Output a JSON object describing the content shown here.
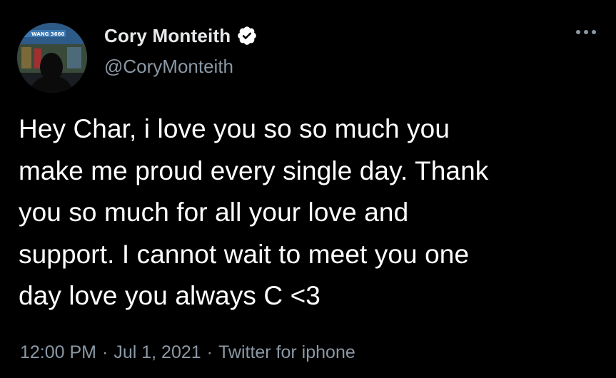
{
  "tweet": {
    "author": {
      "display_name": "Cory Monteith",
      "handle": "@CoryMonteith",
      "verified": true,
      "avatar_sign_text": "WANG 3660"
    },
    "more_icon": "more-horizontal-icon",
    "text": "Hey Char, i love you so so much you\nmake me proud every single day. Thank\nyou so much for all your love and\nsupport. I cannot wait to meet you one\nday love you always C <3",
    "time": "12:00 PM",
    "separator": "·",
    "date": "Jul 1, 2021",
    "source": "Twitter for iphone"
  },
  "colors": {
    "background": "#000000",
    "primary_text": "#ffffff",
    "secondary_text": "#8b98a5",
    "verified_badge": "#ffffff"
  }
}
